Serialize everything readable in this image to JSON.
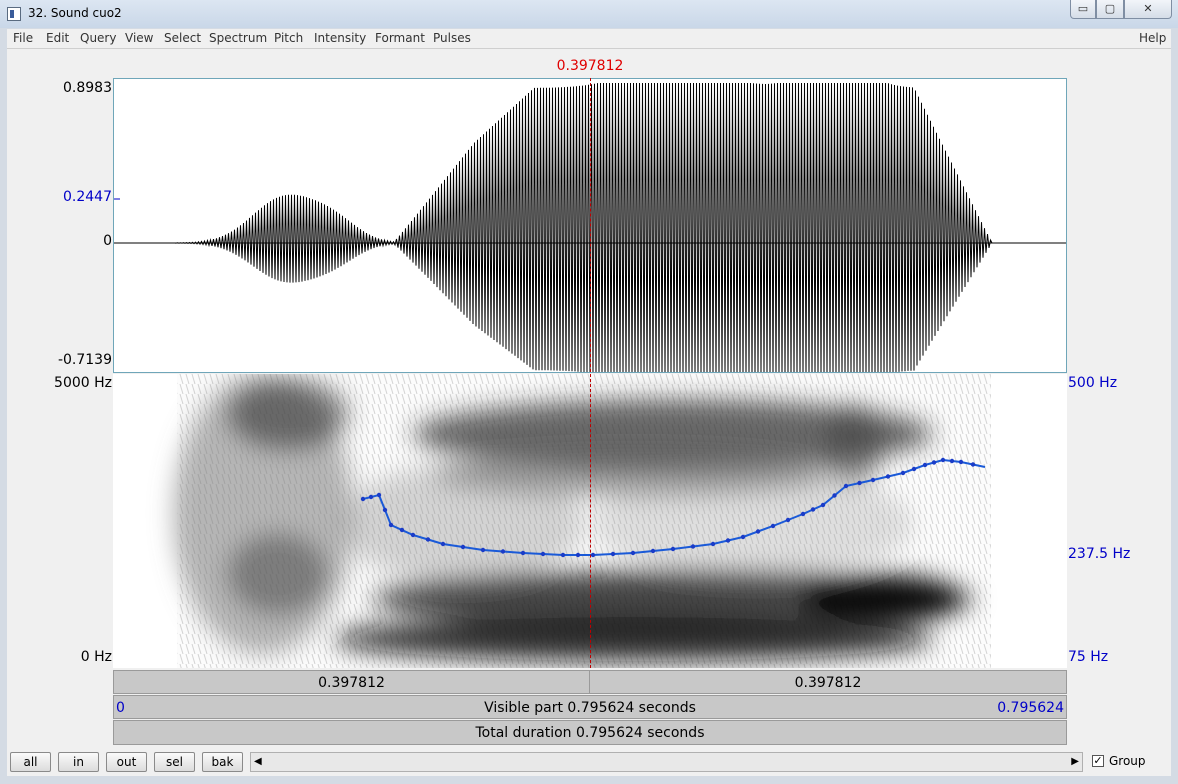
{
  "window": {
    "title": "32. Sound cuo2",
    "minimize_glyph": "▭",
    "maximize_glyph": "▢",
    "close_glyph": "✕"
  },
  "menu": {
    "items": [
      "File",
      "Edit",
      "Query",
      "View",
      "Select",
      "Spectrum",
      "Pitch",
      "Intensity",
      "Formant",
      "Pulses"
    ],
    "help": "Help"
  },
  "cursor": {
    "time": "0.397812"
  },
  "waveform": {
    "max_label": "0.8983",
    "mid_label": "0.2447",
    "zero_label": "0",
    "min_label": "-0.7139"
  },
  "spectrogram": {
    "top_freq": "5000 Hz",
    "bottom_freq": "0 Hz",
    "pitch_top": "500 Hz",
    "pitch_mid": "237.5 Hz",
    "pitch_bottom": "75 Hz"
  },
  "time_bars": {
    "left_part": "0.397812",
    "right_part": "0.397812",
    "visible_start": "0",
    "visible_text": "Visible part 0.795624 seconds",
    "visible_end": "0.795624",
    "total_text": "Total duration 0.795624 seconds"
  },
  "buttons": {
    "all": "all",
    "in": "in",
    "out": "out",
    "sel": "sel",
    "bak": "bak"
  },
  "scroll": {
    "left_glyph": "◀",
    "right_glyph": "▶"
  },
  "group": {
    "label": "Group",
    "checked": true,
    "check_glyph": "✓"
  },
  "colors": {
    "cursor": "#e00000",
    "pitch": "#1a5ad8",
    "axis_blue": "#0000c8"
  }
}
